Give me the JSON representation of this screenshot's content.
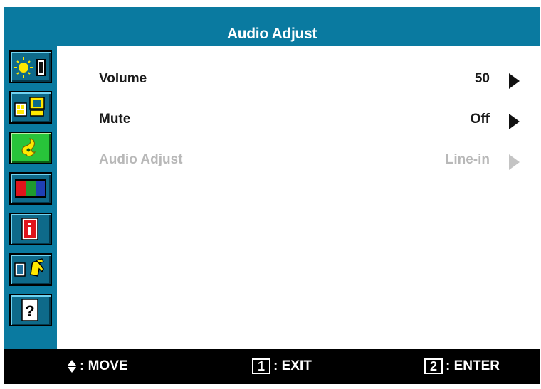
{
  "title": "Audio Adjust",
  "sidebar": {
    "items": [
      {
        "icon": "brightness-contrast-icon",
        "active": false
      },
      {
        "icon": "input-select-icon",
        "active": false
      },
      {
        "icon": "audio-icon",
        "active": true
      },
      {
        "icon": "color-adjust-icon",
        "active": false
      },
      {
        "icon": "information-icon",
        "active": false
      },
      {
        "icon": "manual-image-adjust-icon",
        "active": false
      },
      {
        "icon": "help-icon",
        "active": false
      }
    ]
  },
  "menu": {
    "items": [
      {
        "label": "Volume",
        "value": "50",
        "enabled": true
      },
      {
        "label": "Mute",
        "value": "Off",
        "enabled": true
      },
      {
        "label": "Audio Adjust",
        "value": "Line-in",
        "enabled": false
      }
    ]
  },
  "footer": {
    "move_label": ": MOVE",
    "exit_key": "1",
    "exit_label": ": EXIT",
    "enter_key": "2",
    "enter_label": ": ENTER"
  },
  "colors": {
    "frame": "#0a7aa0",
    "active_icon": "#28c43a",
    "footer_bg": "#000000",
    "disabled_text": "#b8b8b8"
  }
}
